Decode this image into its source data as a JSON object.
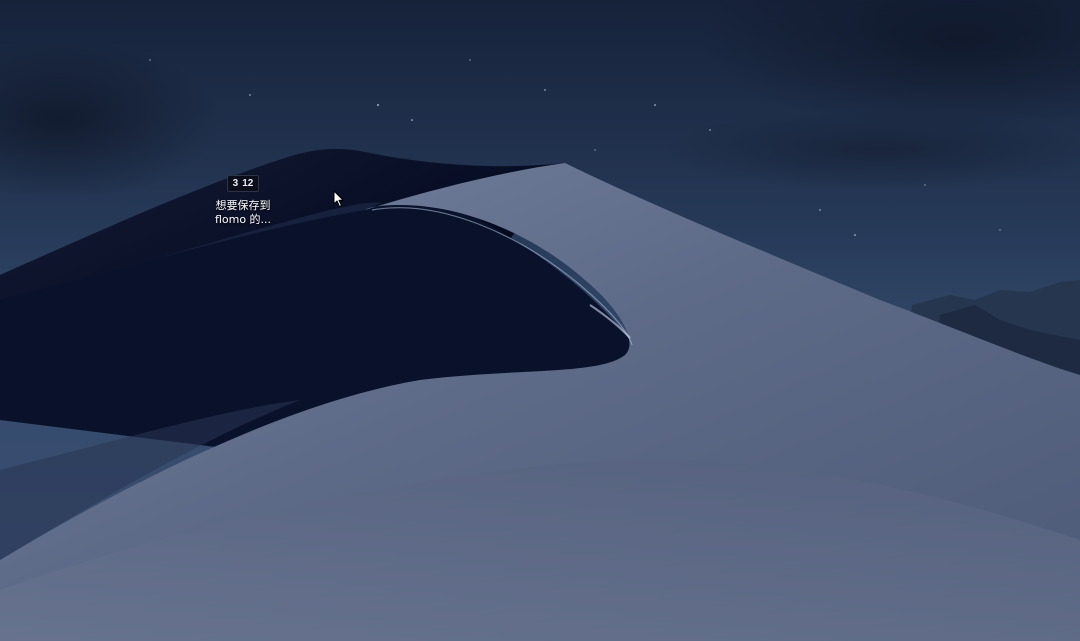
{
  "desktop": {
    "wallpaper": "macos-mojave-night-dunes",
    "colors": {
      "sky_top": "#1a2540",
      "sky_horizon": "#3a5072",
      "dune_light": "#6a7893",
      "dune_shadow": "#0a1128"
    },
    "icons": [
      {
        "thumb_left": "3",
        "thumb_right": "12",
        "label": "想要保存到\nflomo 的..."
      }
    ]
  },
  "cursor": {
    "icon": "arrow-pointer-icon"
  }
}
